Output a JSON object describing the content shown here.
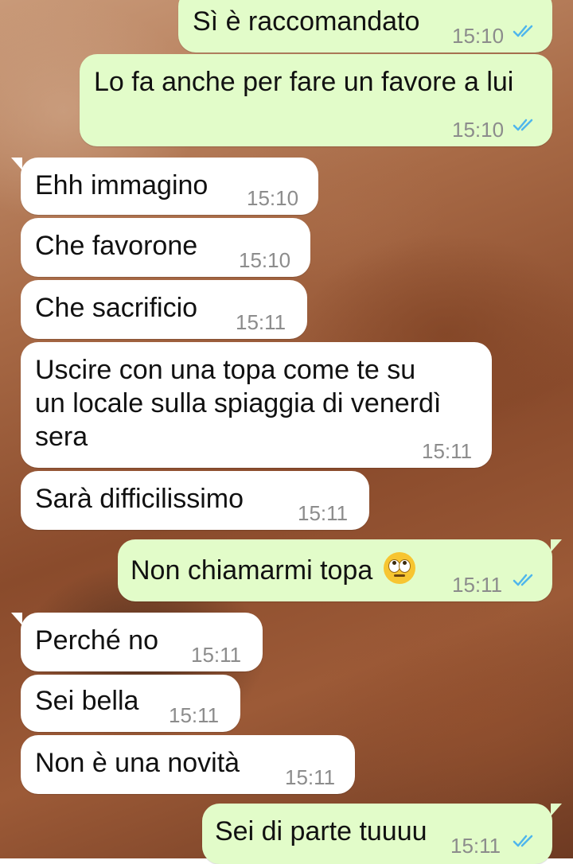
{
  "messages": [
    {
      "text": "Sì è raccomandato",
      "time": "15:10"
    },
    {
      "text": "Lo fa anche per fare un favore a lui",
      "time": "15:10"
    },
    {
      "text": "Ehh immagino",
      "time": "15:10"
    },
    {
      "text": "Che favorone",
      "time": "15:10"
    },
    {
      "text": "Che sacrificio",
      "time": "15:11"
    },
    {
      "lines": [
        "Uscire con una topa come te su",
        "un locale sulla spiaggia di venerdì",
        "sera"
      ],
      "time": "15:11"
    },
    {
      "text": "Sarà difficilissimo",
      "time": "15:11"
    },
    {
      "text": "Non chiamarmi topa",
      "time": "15:11",
      "emoji": "face-with-rolling-eyes"
    },
    {
      "text": "Perché no",
      "time": "15:11"
    },
    {
      "text": "Sei bella",
      "time": "15:11"
    },
    {
      "text": "Non è una novità",
      "time": "15:11"
    },
    {
      "text": "Sei di parte tuuuu",
      "time": "15:11"
    }
  ],
  "colors": {
    "outgoing_bubble": "#e2fcc9",
    "incoming_bubble": "#ffffff",
    "read_ticks": "#4fb6ec",
    "timestamp": "#8c8c8c"
  }
}
